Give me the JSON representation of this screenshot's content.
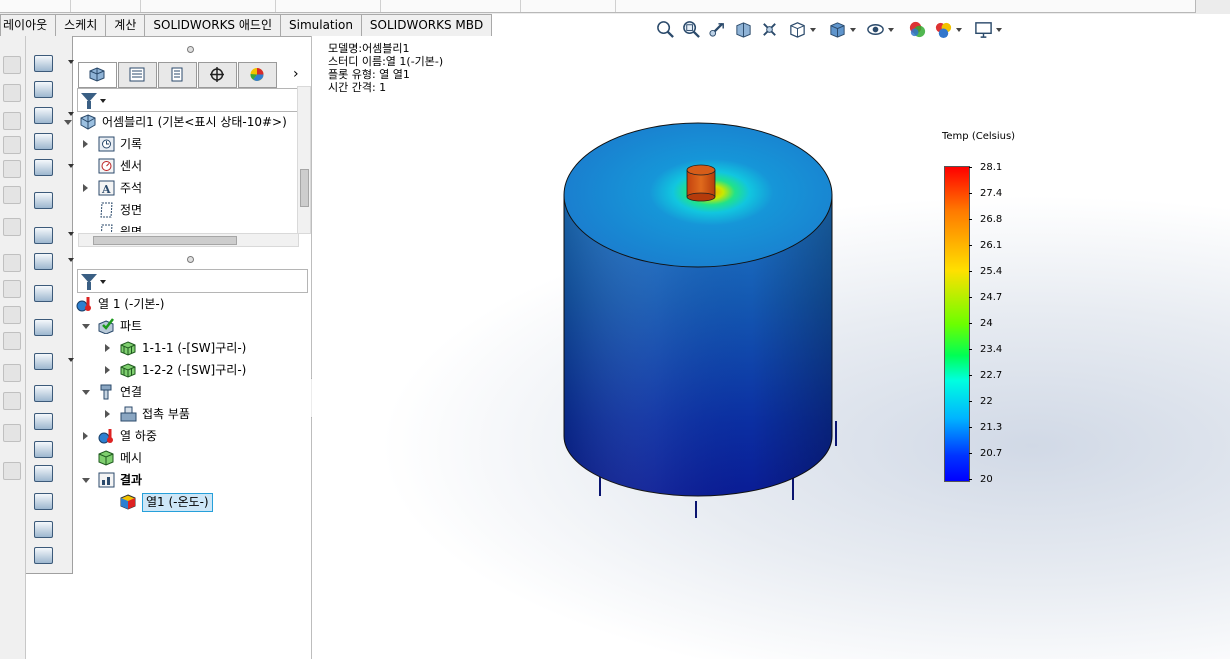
{
  "ribbon_tabs": [
    "레이아웃",
    "스케치",
    "계산",
    "SOLIDWORKS 애드인",
    "Simulation",
    "SOLIDWORKS MBD"
  ],
  "feature_manager": {
    "tabs": [
      "featuremanager-icon",
      "propertymanager-icon",
      "configurationmanager-icon",
      "dimxpert-icon",
      "display-manager-icon"
    ],
    "more_arrow": "›",
    "assembly_tree": [
      {
        "label": "어셈블리1  (기본<표시 상태-10#>)",
        "icon": "assembly-icon",
        "arrow": "down"
      },
      {
        "label": "기록",
        "icon": "history-icon",
        "arrow": "right"
      },
      {
        "label": "센서",
        "icon": "sensor-icon",
        "arrow": "none"
      },
      {
        "label": "주석",
        "icon": "annotation-icon",
        "arrow": "right"
      },
      {
        "label": "정면",
        "icon": "plane-icon",
        "arrow": "none"
      },
      {
        "label": "윗면",
        "icon": "plane-icon",
        "arrow": "none"
      }
    ],
    "study_tree": [
      {
        "label": "열 1 (-기본-)",
        "icon": "thermal-study-icon",
        "arrow": "none"
      },
      {
        "label": "파트",
        "icon": "parts-icon",
        "arrow": "down"
      },
      {
        "label": "1-1-1 (-[SW]구리-)",
        "icon": "part-mesh-icon",
        "arrow": "right"
      },
      {
        "label": "1-2-2 (-[SW]구리-)",
        "icon": "part-mesh-icon",
        "arrow": "right"
      },
      {
        "label": "연결",
        "icon": "connection-icon",
        "arrow": "down"
      },
      {
        "label": "접촉 부품",
        "icon": "contact-icon",
        "arrow": "right"
      },
      {
        "label": "열 하중",
        "icon": "thermal-load-icon",
        "arrow": "right"
      },
      {
        "label": "메시",
        "icon": "mesh-icon",
        "arrow": "none"
      },
      {
        "label": "결과",
        "icon": "results-icon",
        "arrow": "down",
        "bold": true
      },
      {
        "label": "열1 (-온도-)",
        "icon": "temperature-plot-icon",
        "arrow": "none",
        "selected": true
      }
    ]
  },
  "plot_info": {
    "model": "모델명:어셈블리1",
    "study": "스터디 이름:열 1(-기본-)",
    "plot_type": "플롯 유형: 열 열1",
    "time_step": "시간 간격: 1"
  },
  "legend": {
    "title": "Temp (Celsius)",
    "values": [
      "28.1",
      "27.4",
      "26.8",
      "26.1",
      "25.4",
      "24.7",
      "24",
      "23.4",
      "22.7",
      "22",
      "21.3",
      "20.7",
      "20"
    ],
    "max_color": "#ff0000",
    "min_color": "#0000ff"
  },
  "heads_up_toolbar": [
    "zoom-fit-icon",
    "zoom-area-icon",
    "previous-view-icon",
    "section-view-icon",
    "dynamic-annotation-icon",
    "view-orientation-icon",
    "display-style-icon",
    "hide-show-icon",
    "edit-appearance-icon",
    "apply-scene-icon",
    "view-settings-icon"
  ]
}
